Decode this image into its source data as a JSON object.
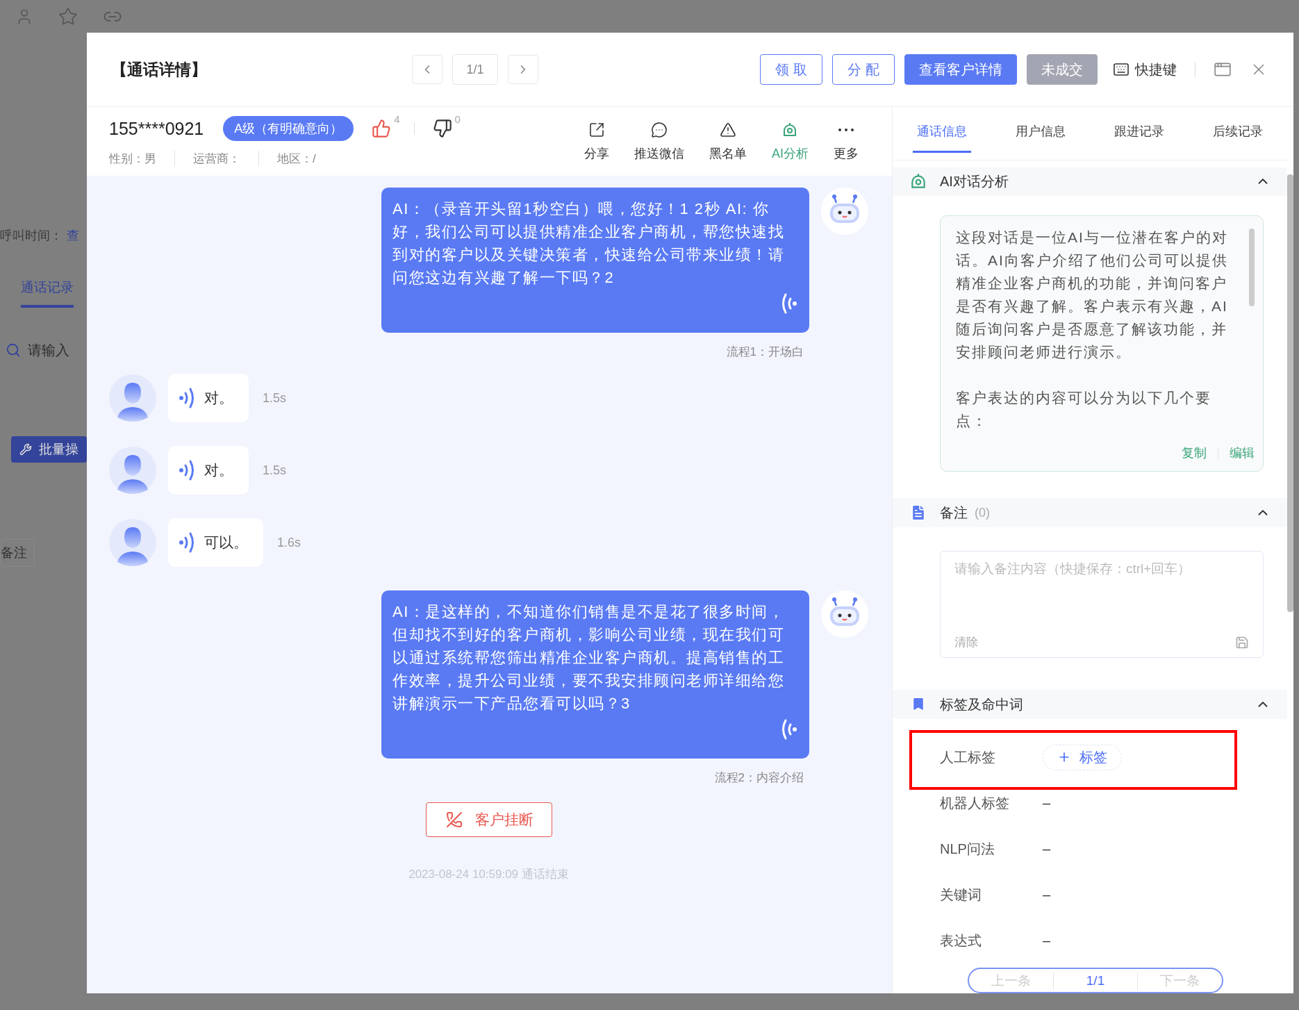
{
  "background": {
    "call_time_label": "呼叫时间：",
    "call_time_link": "查",
    "tab": "通话记录",
    "search_placeholder": "请输入",
    "batch_button": "批量操",
    "note_button": "备注"
  },
  "dialog": {
    "title": "【通话详情】",
    "pager": "1/1",
    "shortcut": "快捷键",
    "buttons": [
      {
        "label": "领 取",
        "kind": "outline"
      },
      {
        "label": "分 配",
        "kind": "outline"
      },
      {
        "label": "查看客户详情",
        "kind": "primary"
      },
      {
        "label": "未成交",
        "kind": "muted"
      }
    ]
  },
  "customer": {
    "phone": "155****0921",
    "level_badge": "A级（有明确意向）",
    "likes": "4",
    "dislikes": "0",
    "fields": [
      "性别：男",
      "运营商：",
      "地区：/"
    ]
  },
  "actions": [
    {
      "label": "分享",
      "kind": "share",
      "selected": false
    },
    {
      "label": "推送微信",
      "kind": "wechat",
      "selected": false
    },
    {
      "label": "黑名单",
      "kind": "blacklist",
      "selected": false
    },
    {
      "label": "AI分析",
      "kind": "ai",
      "selected": true
    },
    {
      "label": "更多",
      "kind": "more",
      "selected": false
    }
  ],
  "messages": [
    {
      "kind": "bot",
      "text": "AI：（录音开头留1秒空白）喂，您好！1 2秒 AI: 你好，我们公司可以提供精准企业客户商机，帮您快速找到对的客户以及关键决策者，快速给公司带来业绩！请问您这边有兴趣了解一下吗？2",
      "flow": "流程1：开场白"
    },
    {
      "kind": "user",
      "text": "对。",
      "duration": "1.5s"
    },
    {
      "kind": "user",
      "text": "对。",
      "duration": "1.5s"
    },
    {
      "kind": "user",
      "text": "可以。",
      "duration": "1.6s"
    },
    {
      "kind": "bot",
      "text": "AI：是这样的，不知道你们销售是不是花了很多时间，但却找不到好的客户商机，影响公司业绩，现在我们可以通过系统帮您筛出精准企业客户商机。提高销售的工作效率，提升公司业绩，要不我安排顾问老师详细给您讲解演示一下产品您看可以吗？3",
      "flow": "流程2：内容介绍"
    }
  ],
  "hangup": "客户挂断",
  "end_note": "2023-08-24 10:59:09 通话结束",
  "side_tabs": [
    {
      "label": "通话信息",
      "selected": true
    },
    {
      "label": "用户信息",
      "selected": false
    },
    {
      "label": "跟进记录",
      "selected": false
    },
    {
      "label": "后续记录",
      "selected": false
    }
  ],
  "ai_section": {
    "title": "AI对话分析",
    "expanded": true,
    "paragraphs": [
      "这段对话是一位AI与一位潜在客户的对话。AI向客户介绍了他们公司可以提供精准企业客户商机的功能，并询问客户是否有兴趣了解。客户表示有兴趣，AI随后询问客户是否愿意了解该功能，并安排顾问老师进行演示。",
      "客户表达的内容可以分为以下几个要点："
    ],
    "actions": [
      "复制",
      "编辑"
    ]
  },
  "note_section": {
    "title": "备注",
    "count": "(0)",
    "expanded": true,
    "placeholder": "请输入备注内容（快捷保存：ctrl+回车）",
    "clear": "清除"
  },
  "tags_section": {
    "title": "标签及命中词",
    "expanded": true,
    "rows": [
      {
        "label": "人工标签",
        "kind": "button",
        "value": "标签"
      },
      {
        "label": "机器人标签",
        "kind": "text",
        "value": "–"
      },
      {
        "label": "NLP问法",
        "kind": "text",
        "value": "–"
      },
      {
        "label": "关键词",
        "kind": "text",
        "value": "–"
      },
      {
        "label": "表达式",
        "kind": "text",
        "value": "–"
      }
    ]
  },
  "pager": {
    "prev": "上一条",
    "page": "1/1",
    "next": "下一条"
  }
}
